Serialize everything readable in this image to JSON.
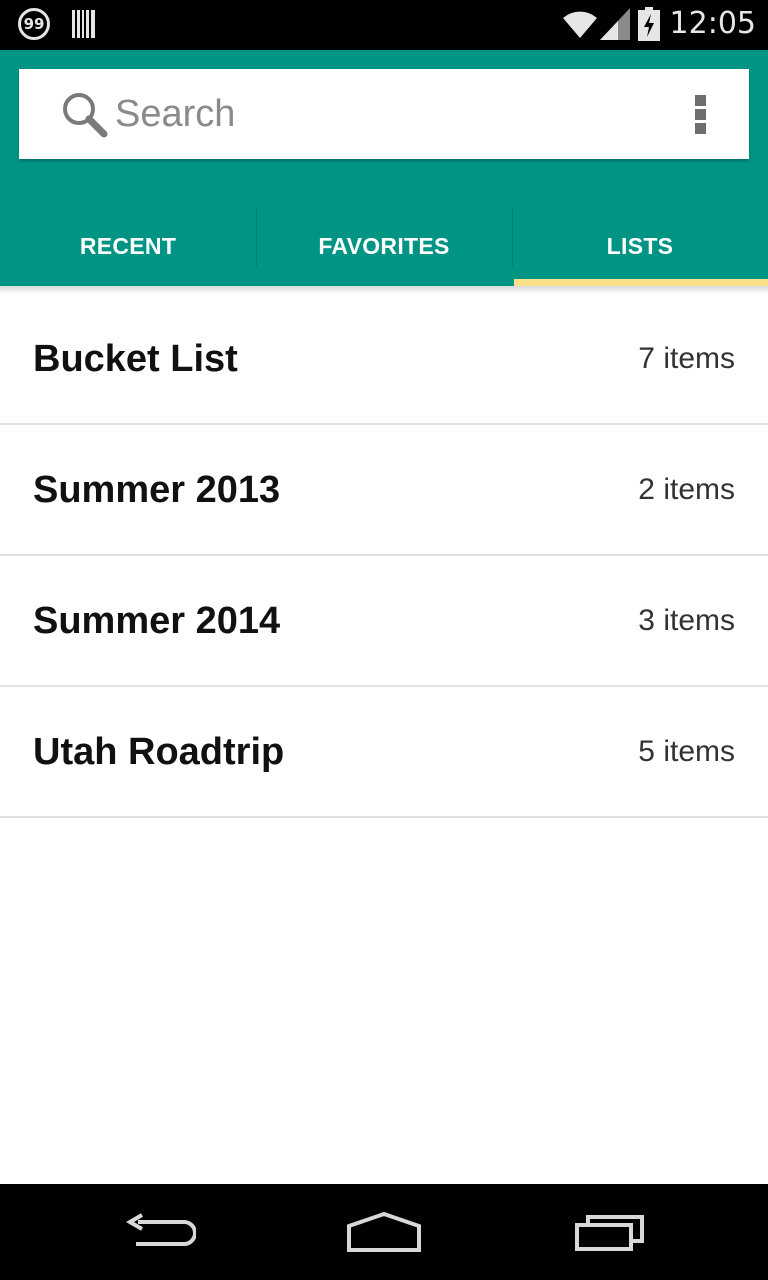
{
  "status_bar": {
    "notification_badge": "99",
    "time": "12:05",
    "icons": [
      "notification-99-icon",
      "barcode-icon",
      "wifi-icon",
      "signal-icon",
      "battery-icon"
    ]
  },
  "search": {
    "placeholder": "Search"
  },
  "tabs": [
    {
      "label": "RECENT",
      "selected": false
    },
    {
      "label": "FAVORITES",
      "selected": false
    },
    {
      "label": "LISTS",
      "selected": true
    }
  ],
  "lists": [
    {
      "name": "Bucket List",
      "count": "7 items"
    },
    {
      "name": "Summer 2013",
      "count": "2 items"
    },
    {
      "name": "Summer 2014",
      "count": "3 items"
    },
    {
      "name": "Utah Roadtrip",
      "count": "5 items"
    }
  ],
  "nav_bar": {
    "icons": [
      "back-icon",
      "home-icon",
      "recents-icon"
    ]
  },
  "colors": {
    "primary": "#009485",
    "tab_indicator": "#fde08a",
    "status_bar": "#000000"
  }
}
